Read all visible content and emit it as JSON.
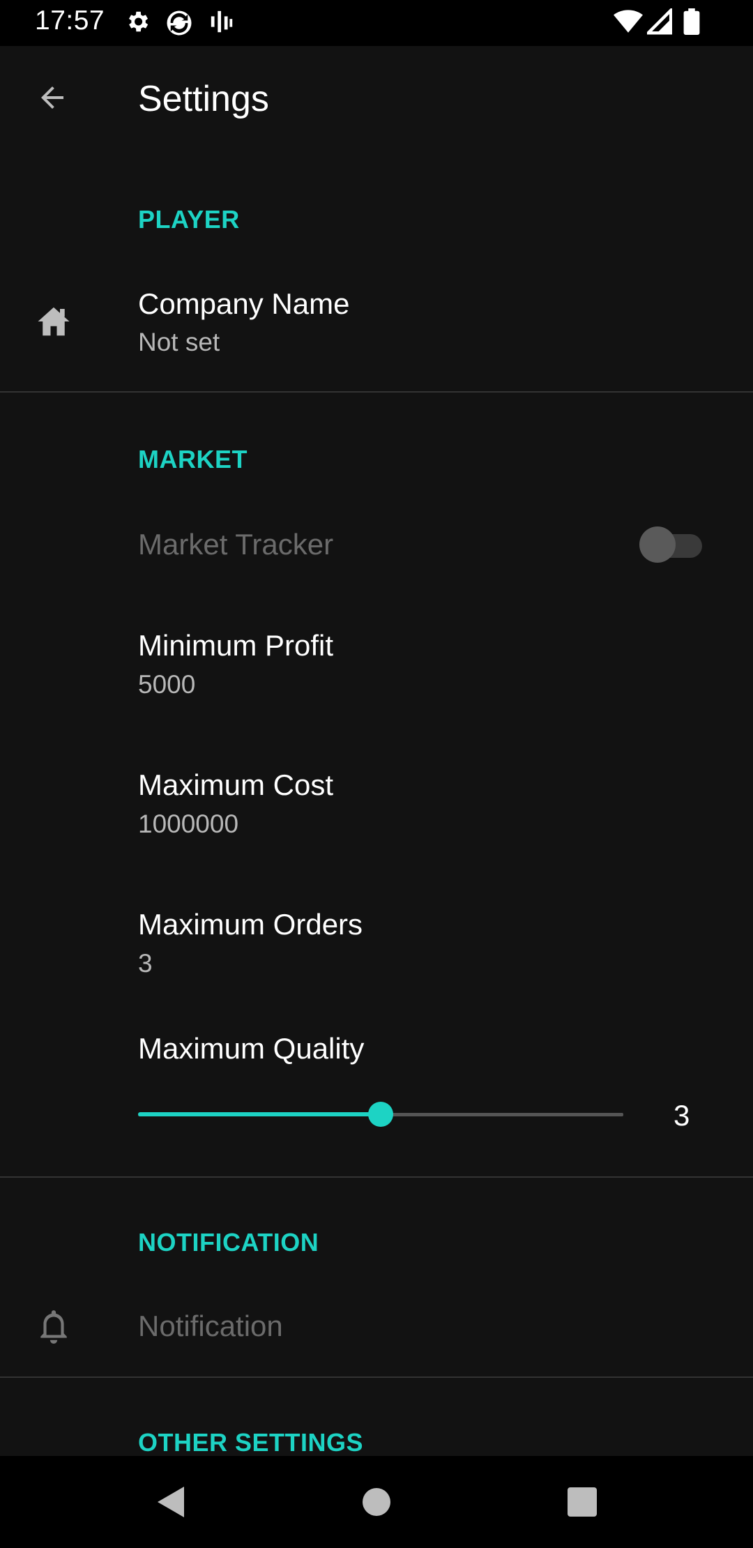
{
  "status_bar": {
    "time": "17:57"
  },
  "toolbar": {
    "title": "Settings"
  },
  "sections": {
    "player": {
      "header": "PLAYER",
      "company_name": {
        "title": "Company Name",
        "summary": "Not set"
      }
    },
    "market": {
      "header": "MARKET",
      "market_tracker": {
        "title": "Market Tracker",
        "enabled": false,
        "checked": false
      },
      "minimum_profit": {
        "title": "Minimum Profit",
        "summary": "5000"
      },
      "maximum_cost": {
        "title": "Maximum Cost",
        "summary": "1000000"
      },
      "maximum_orders": {
        "title": "Maximum Orders",
        "summary": "3"
      },
      "maximum_quality": {
        "title": "Maximum Quality",
        "value": "3",
        "fraction": 0.5
      }
    },
    "notification": {
      "header": "NOTIFICATION",
      "notification": {
        "title": "Notification",
        "enabled": false
      }
    },
    "other": {
      "header": "OTHER SETTINGS"
    }
  },
  "colors": {
    "accent": "#1dd3c4",
    "background": "#121212"
  },
  "icons": {
    "back": "arrow-left-icon",
    "company": "home-icon",
    "notification": "bell-icon"
  }
}
